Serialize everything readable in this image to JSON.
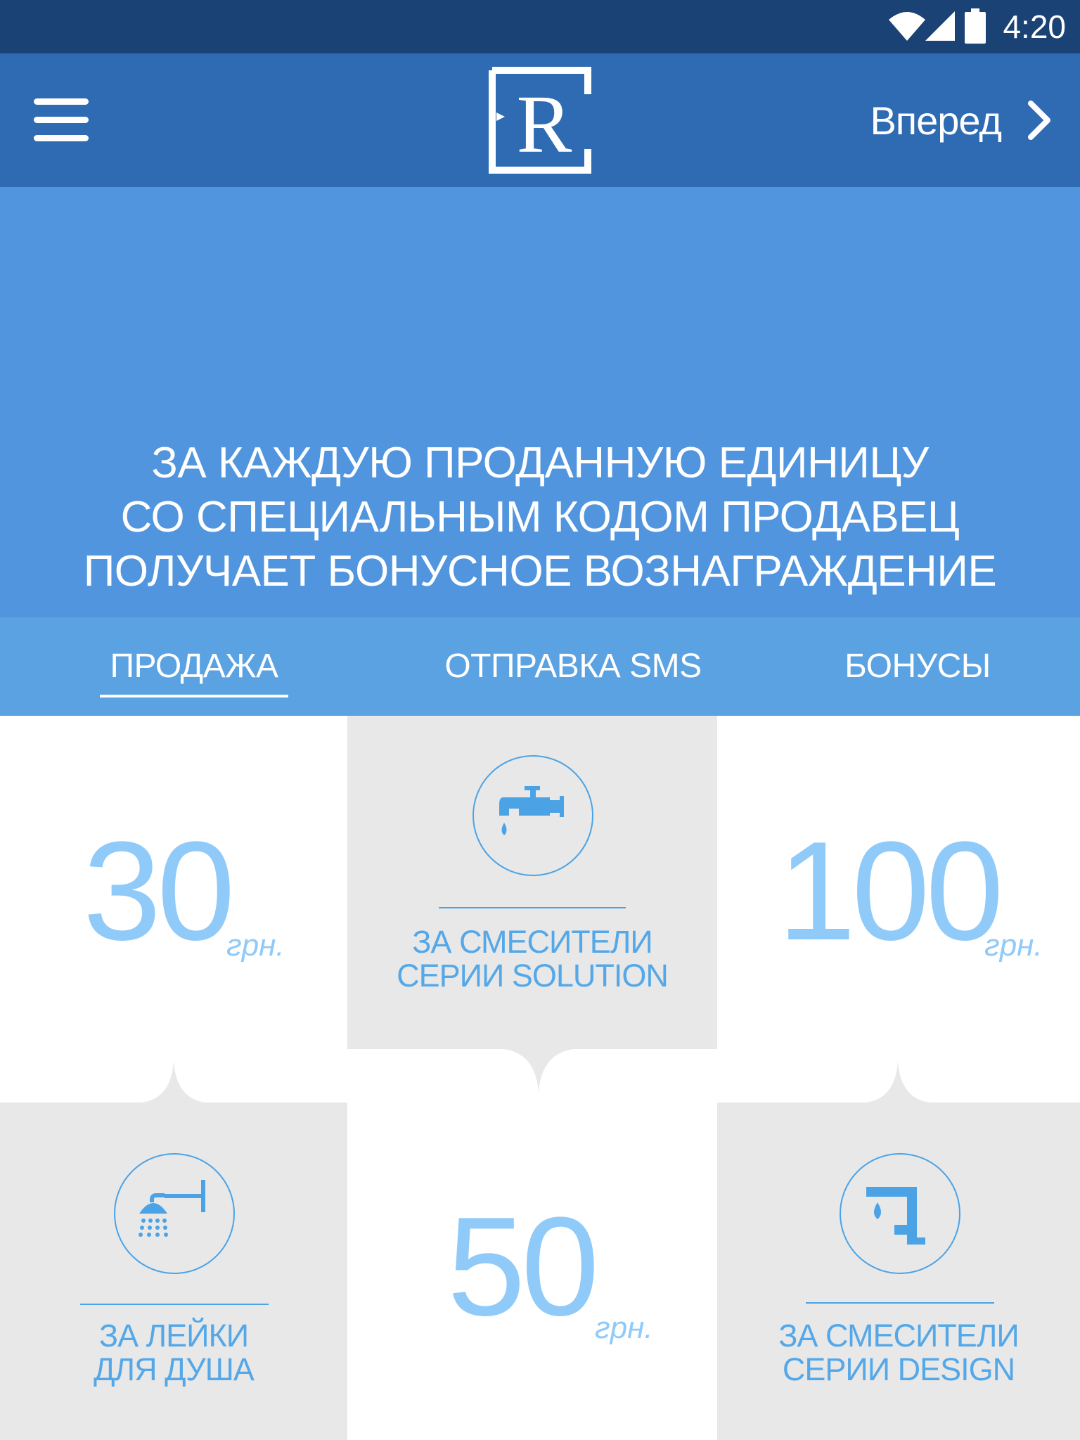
{
  "status_bar": {
    "time": "4:20",
    "icons": [
      "wifi-icon",
      "cell-signal-icon",
      "battery-icon"
    ]
  },
  "app_bar": {
    "menu_icon": "hamburger-menu-icon",
    "logo_letter": "R",
    "forward_label": "Вперед",
    "forward_icon": "chevron-right-icon"
  },
  "hero": {
    "lines": [
      "ЗА КАЖДУЮ ПРОДАННУЮ ЕДИНИЦУ",
      "СО СПЕЦИАЛЬНЫМ КОДОМ ПРОДАВЕЦ",
      "ПОЛУЧАЕТ БОНУСНОЕ ВОЗНАГРАЖДЕНИЕ"
    ]
  },
  "tabs": [
    {
      "label": "ПРОДАЖА",
      "active": true
    },
    {
      "label": "ОТПРАВКА SMS",
      "active": false
    },
    {
      "label": "БОНУСЫ",
      "active": false
    }
  ],
  "bonuses": {
    "solution": {
      "amount": "30",
      "unit": "грн.",
      "caption_1": "ЗА СМЕСИТЕЛИ",
      "caption_2": "СЕРИИ SOLUTION",
      "icon": "faucet-icon"
    },
    "design": {
      "amount": "100",
      "unit": "грн.",
      "caption_1": "ЗА СМЕСИТЕЛИ",
      "caption_2": "СЕРИИ DESIGN",
      "icon": "design-faucet-icon"
    },
    "shower": {
      "amount": "50",
      "unit": "грн.",
      "caption_1": "ЗА ЛЕЙКИ",
      "caption_2": "ДЛЯ ДУША",
      "icon": "shower-head-icon"
    }
  },
  "colors": {
    "status_bar": "#1b4275",
    "app_bar": "#2f6bb3",
    "hero": "#5095de",
    "tabs": "#5aa2e1",
    "number": "#90caf9",
    "accent_line": "#4ba3e6",
    "grey_tile": "#e8e8e8"
  }
}
